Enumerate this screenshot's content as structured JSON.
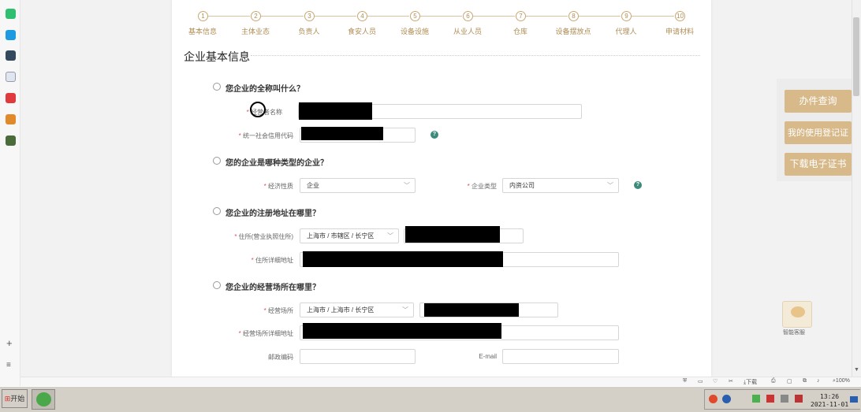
{
  "steps": [
    "基本信息",
    "主体业态",
    "负责人",
    "食安人员",
    "设备设施",
    "从业人员",
    "仓库",
    "设备摆放点",
    "代理人",
    "申请材料"
  ],
  "step_numbers": [
    "1",
    "2",
    "3",
    "4",
    "5",
    "6",
    "7",
    "8",
    "9",
    "10"
  ],
  "section_title": "企业基本信息",
  "questions": {
    "q1": "您企业的全称叫什么？",
    "q2": "您的企业是哪种类型的企业？",
    "q3": "您企业的注册地址在哪里？",
    "q4": "您企业的经营场所在哪里？"
  },
  "fields": {
    "operator_name_label": "经营者名称",
    "credit_code_label": "统一社会信用代码",
    "econ_nature_label": "经济性质",
    "econ_nature_value": "企业",
    "company_type_label": "企业类型",
    "company_type_value": "内资公司",
    "reg_addr_label": "住所(营业执照住所)",
    "reg_addr_value": "上海市 / 市辖区 / 长宁区",
    "reg_addr_detail_label": "住所详细地址",
    "biz_addr_label": "经营场所",
    "biz_addr_value": "上海市 / 上海市 / 长宁区",
    "biz_addr_detail_label": "经营场所详细地址",
    "postcode_label": "邮政编码",
    "email_label": "E-mail"
  },
  "right_buttons": [
    "办件查询",
    "我的使用登记证",
    "下载电子证书"
  ],
  "assistant_label": "智能客服",
  "statusbar": {
    "download": "下载",
    "zoom": "100%"
  },
  "taskbar": {
    "start": "开始",
    "time": "13:26",
    "date": "2021-11-01"
  },
  "colors": {
    "accent": "#c9a873",
    "button": "#d7b98a",
    "help": "#3d8a7a"
  }
}
